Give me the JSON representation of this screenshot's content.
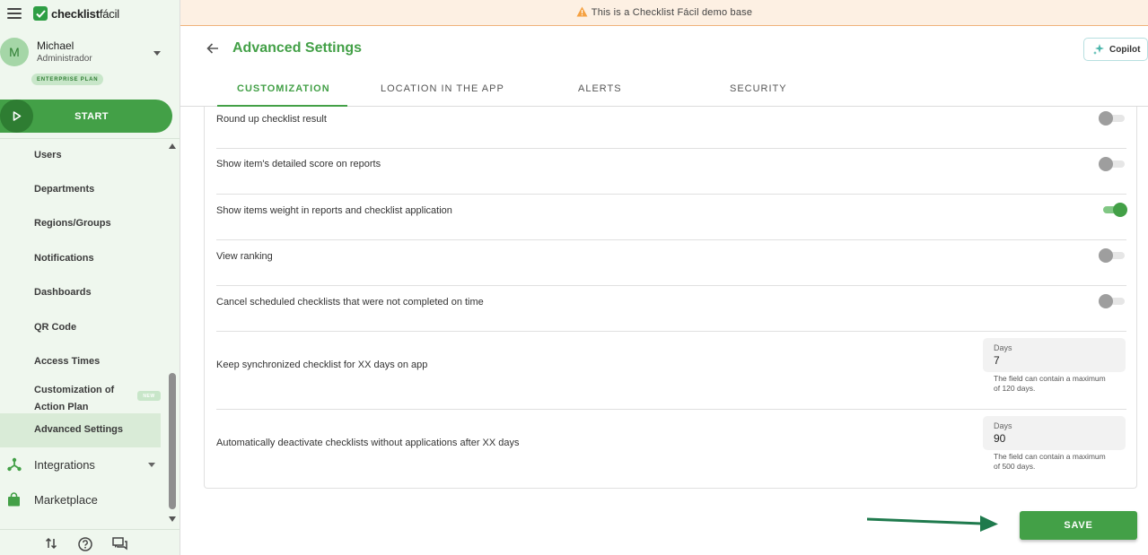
{
  "app": {
    "brand_bold": "checklist",
    "brand_regular": "fácil"
  },
  "user": {
    "initial": "M",
    "name": "Michael",
    "role": "Administrador",
    "plan": "ENTERPRISE PLAN"
  },
  "start_label": "START",
  "nav": {
    "items": [
      {
        "label": "Users"
      },
      {
        "label": "Departments"
      },
      {
        "label": "Regions/Groups"
      },
      {
        "label": "Notifications"
      },
      {
        "label": "Dashboards"
      },
      {
        "label": "QR Code"
      },
      {
        "label": "Access Times"
      },
      {
        "label": "Customization of Action Plan",
        "badge": "NEW"
      },
      {
        "label": "Advanced Settings",
        "active": true
      }
    ],
    "integrations": "Integrations",
    "marketplace": "Marketplace"
  },
  "banner": {
    "text": "This is a Checklist Fácil demo base"
  },
  "header": {
    "title": "Advanced Settings",
    "copilot": "Copilot"
  },
  "tabs": [
    {
      "label": "CUSTOMIZATION",
      "active": true
    },
    {
      "label": "LOCATION IN THE APP"
    },
    {
      "label": "ALERTS"
    },
    {
      "label": "SECURITY"
    }
  ],
  "settings": {
    "toggles": [
      {
        "label": "Round up checklist result",
        "on": false
      },
      {
        "label": "Show item's detailed score on reports",
        "on": false
      },
      {
        "label": "Show items weight in reports and checklist application",
        "on": true
      },
      {
        "label": "View ranking",
        "on": false
      },
      {
        "label": "Cancel scheduled checklists that were not completed on time",
        "on": false
      }
    ],
    "keep_sync": {
      "label": "Keep synchronized checklist for XX days on app",
      "field_label": "Days",
      "value": "7",
      "helper": "The field can contain a maximum of 120 days."
    },
    "auto_deactivate": {
      "label": "Automatically deactivate checklists without applications after XX days",
      "field_label": "Days",
      "value": "90",
      "helper": "The field can contain a maximum of 500 days."
    }
  },
  "save_label": "SAVE",
  "colors": {
    "brand_green": "#43a047",
    "dark_green": "#2e7d32",
    "sidebar_bg": "#eff7ee",
    "banner_bg": "#fdf0e3",
    "warning": "#f5a142"
  }
}
